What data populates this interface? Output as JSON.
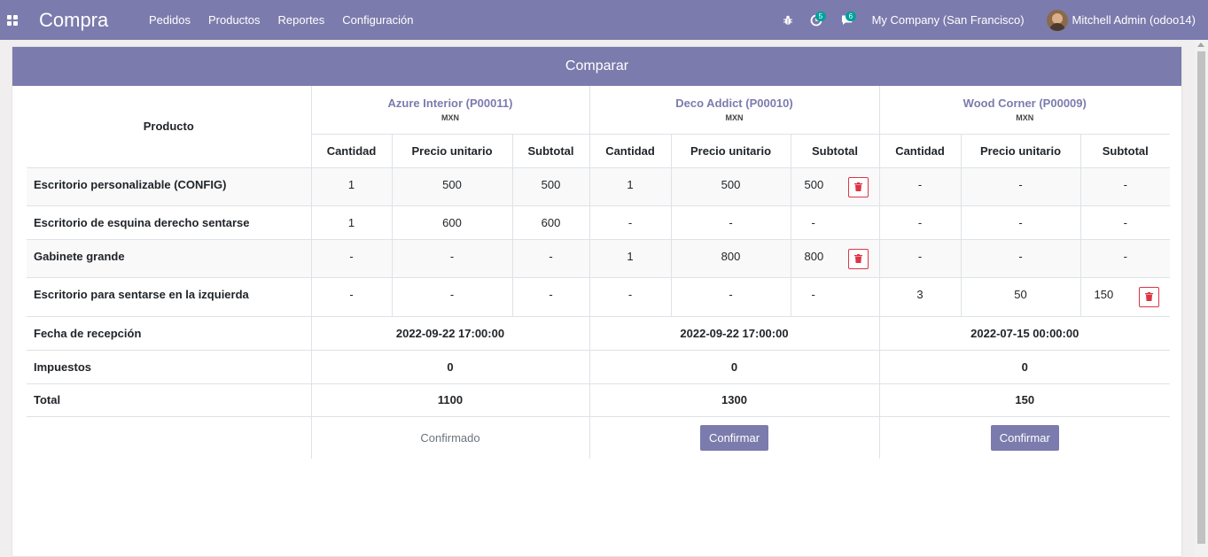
{
  "navbar": {
    "brand": "Compra",
    "menu": [
      "Pedidos",
      "Productos",
      "Reportes",
      "Configuración"
    ],
    "activity_count": "5",
    "message_count": "6",
    "company": "My Company (San Francisco)",
    "user": "Mitchell Admin (odoo14)"
  },
  "sheet": {
    "title": "Comparar"
  },
  "table": {
    "product_header": "Producto",
    "vendors": [
      {
        "name": "Azure Interior (P00011)",
        "currency": "MXN",
        "date": "2022-09-22 17:00:00",
        "taxes": "0",
        "total": "1100",
        "status": "Confirmado"
      },
      {
        "name": "Deco Addict (P00010)",
        "currency": "MXN",
        "date": "2022-09-22 17:00:00",
        "taxes": "0",
        "total": "1300",
        "action": "Confirmar"
      },
      {
        "name": "Wood Corner (P00009)",
        "currency": "MXN",
        "date": "2022-07-15 00:00:00",
        "taxes": "0",
        "total": "150",
        "action": "Confirmar"
      }
    ],
    "col_headers": {
      "qty": "Cantidad",
      "price": "Precio unitario",
      "subtotal": "Subtotal"
    },
    "rows": [
      {
        "product": "Escritorio personalizable (CONFIG)",
        "cells": [
          "1",
          "500",
          "500",
          "1",
          "500",
          "500",
          "-",
          "-",
          "-"
        ]
      },
      {
        "product": "Escritorio de esquina derecho sentarse",
        "cells": [
          "1",
          "600",
          "600",
          "-",
          "-",
          "-",
          "-",
          "-",
          "-"
        ]
      },
      {
        "product": "Gabinete grande",
        "cells": [
          "-",
          "-",
          "-",
          "1",
          "800",
          "800",
          "-",
          "-",
          "-"
        ]
      },
      {
        "product": "Escritorio para sentarse en la izquierda",
        "cells": [
          "-",
          "-",
          "-",
          "-",
          "-",
          "-",
          "3",
          "50",
          "150"
        ]
      }
    ],
    "summary_labels": {
      "date": "Fecha de recepción",
      "taxes": "Impuestos",
      "total": "Total"
    }
  },
  "colors": {
    "primary": "#7c7bad",
    "danger": "#dc3545",
    "badge": "#00a09d"
  }
}
